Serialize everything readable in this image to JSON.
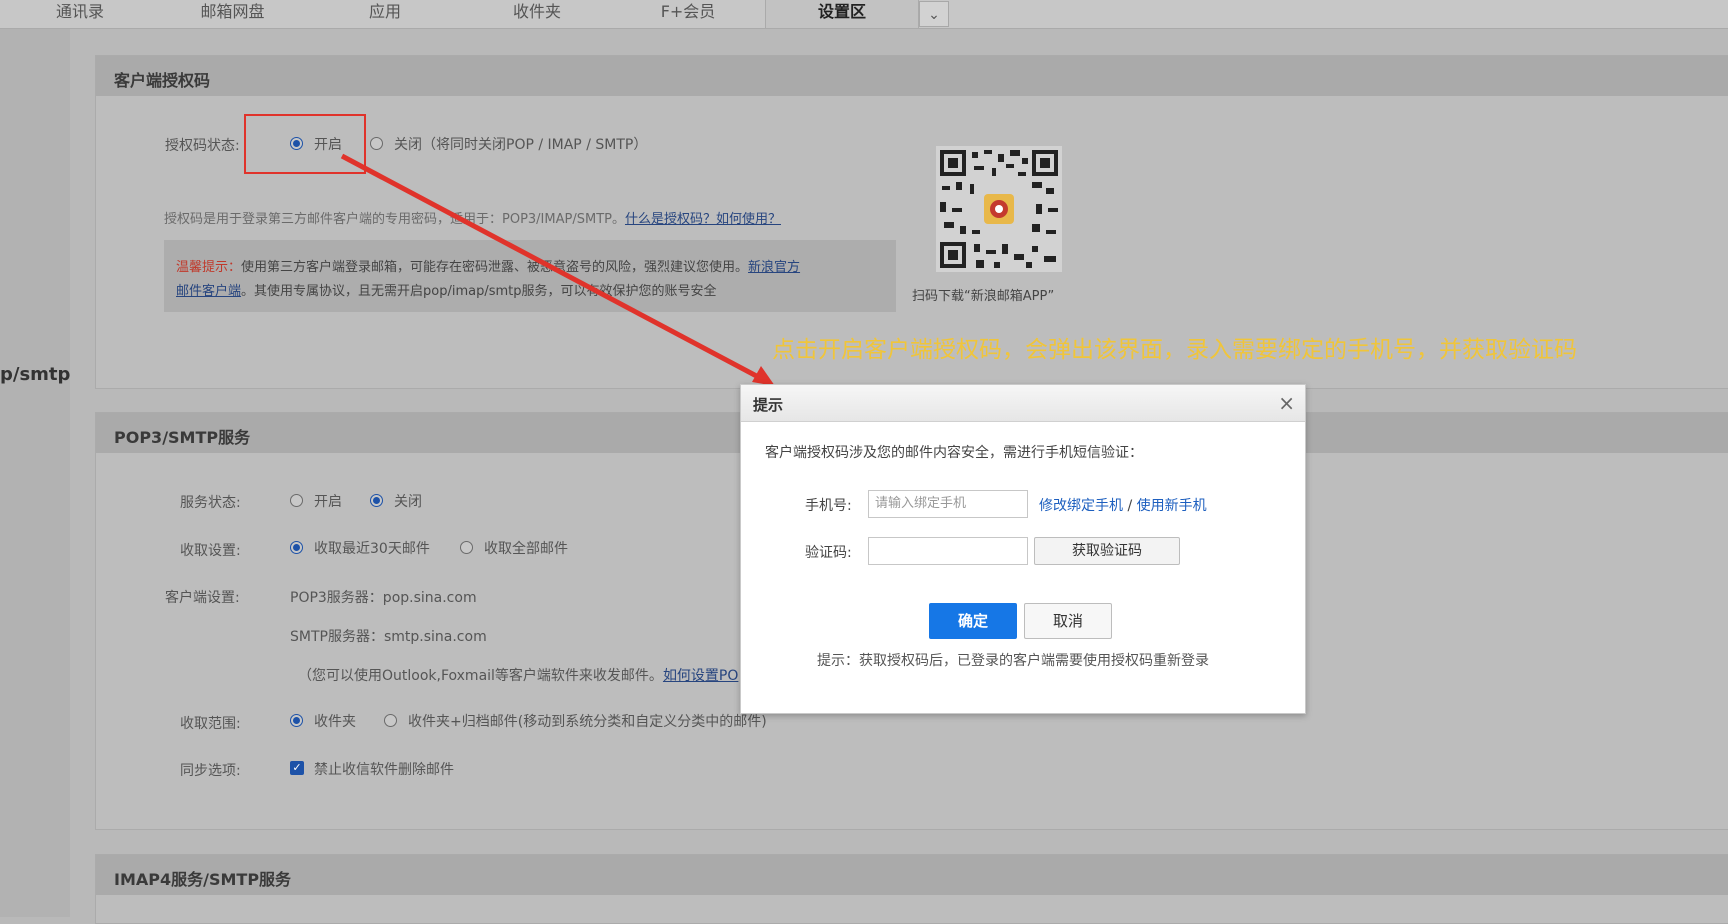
{
  "nav": {
    "tabs": [
      "通讯录",
      "邮箱网盘",
      "应用",
      "收件夹",
      "F+会员",
      "设置区"
    ],
    "more_icon": "chevron-down-icon"
  },
  "sidebar": {
    "clipped_label": "p/smtp"
  },
  "auth_section": {
    "title": "客户端授权码",
    "status_label": "授权码状态:",
    "on_label": "开启",
    "off_label": "关闭（将同时关闭POP / IMAP / SMTP）",
    "desc": "授权码是用于登录第三方邮件客户端的专用密码，适用于：POP3/IMAP/SMTP。",
    "desc_link": "什么是授权码？如何使用？",
    "warn_prefix": "温馨提示：",
    "warn_text1": "使用第三方客户端登录邮箱，可能存在密码泄露、被恶意盗号的风险，强烈建议您使用。",
    "warn_link1": "新浪官方",
    "warn_link2": "邮件客户端",
    "warn_text2": "。其使用专属协议，且无需开启pop/imap/smtp服务，可以有效保护您的账号安全",
    "qr_caption": "扫码下载“新浪邮箱APP”"
  },
  "pop_section": {
    "title": "POP3/SMTP服务",
    "service_label": "服务状态:",
    "service_on": "开启",
    "service_off": "关闭",
    "fetch_label": "收取设置:",
    "fetch_recent": "收取最近30天邮件",
    "fetch_all": "收取全部邮件",
    "client_label": "客户端设置:",
    "pop_server": "POP3服务器：pop.sina.com",
    "smtp_server": "SMTP服务器：smtp.sina.com",
    "client_note": "（您可以使用Outlook,Foxmail等客户端软件来收发邮件。",
    "client_note_link": "如何设置PO",
    "range_label": "收取范围:",
    "range_inbox": "收件夹",
    "range_all": "收件夹+归档邮件(移动到系统分类和自定义分类中的邮件)",
    "sync_label": "同步选项:",
    "sync_option": "禁止收信软件删除邮件"
  },
  "imap_section": {
    "title": "IMAP4服务/SMTP服务"
  },
  "annotation": "点击开启客户端授权码，会弹出该界面，录入需要绑定的手机号，并获取验证码",
  "modal": {
    "title": "提示",
    "intro": "客户端授权码涉及您的邮件内容安全，需进行手机短信验证：",
    "phone_label": "手机号:",
    "phone_placeholder": "请输入绑定手机",
    "link_modify": "修改绑定手机",
    "link_sep": "/",
    "link_new": "使用新手机",
    "code_label": "验证码:",
    "get_code": "获取验证码",
    "confirm": "确定",
    "cancel": "取消",
    "tip": "提示：获取授权码后，已登录的客户端需要使用授权码重新登录"
  },
  "colors": {
    "accent": "#1d52a8",
    "highlight": "#e0332b",
    "annotation": "#f0c53a",
    "confirm": "#1677e6"
  }
}
